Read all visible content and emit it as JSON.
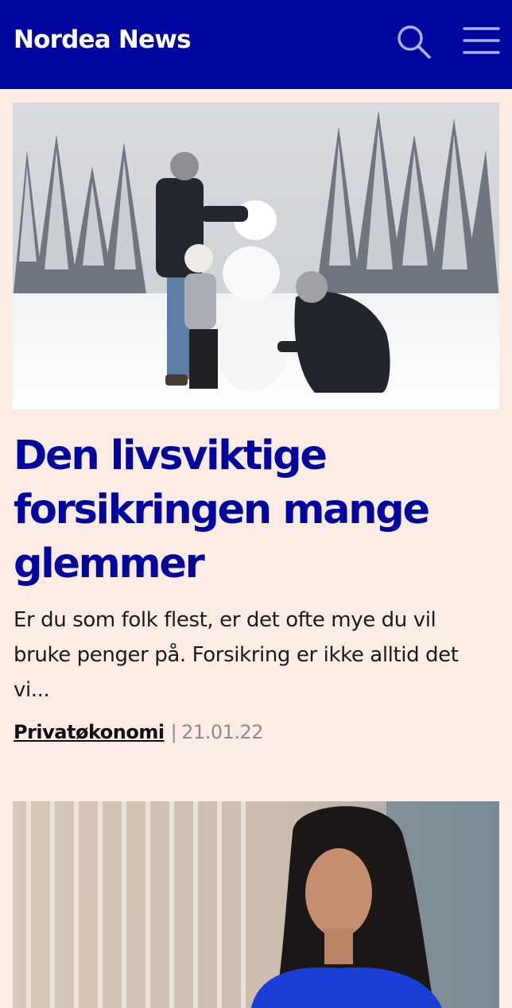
{
  "header": {
    "brand": "Nordea News",
    "search_icon": "search-icon",
    "menu_icon": "hamburger-menu-icon"
  },
  "articles": [
    {
      "headline": "Den livsviktige forsikringen mange glemmer",
      "excerpt": "Er du som folk flest, er det ofte mye du vil bruke penger på. Forsikring er ikke alltid det vi...",
      "category": "Privatøkonomi",
      "separator": "|",
      "date": "21.01.22"
    }
  ],
  "colors": {
    "brand_blue": "#00059e",
    "background": "#fbede6"
  }
}
